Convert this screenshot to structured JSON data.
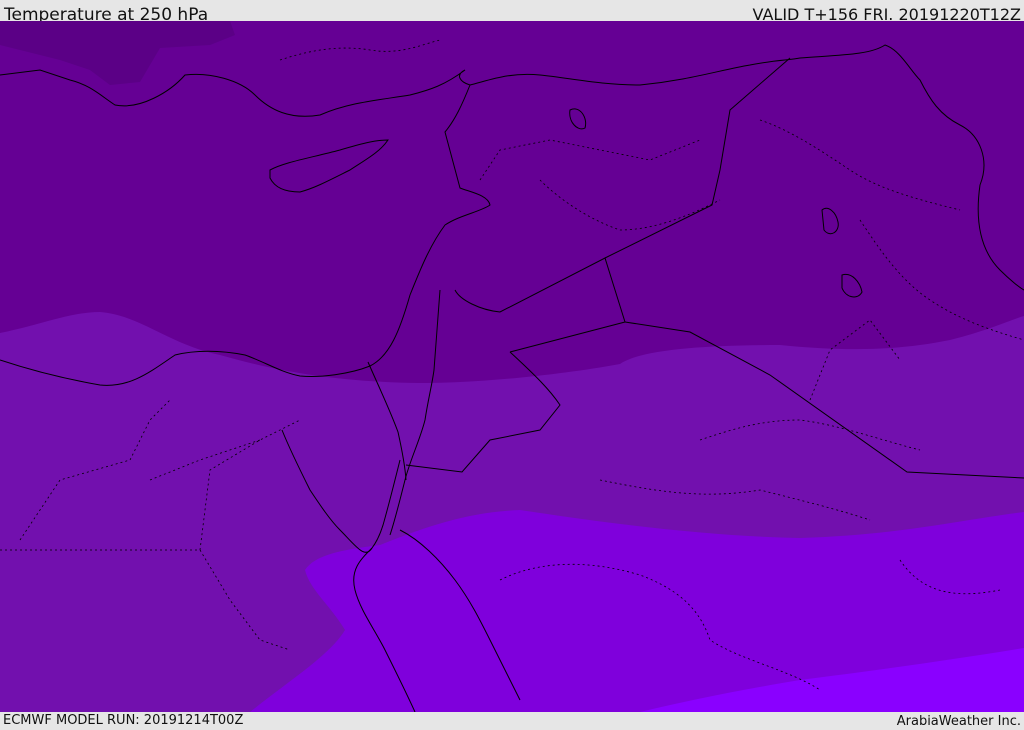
{
  "header": {
    "title": "Temperature at 250 hPa",
    "valid": "VALID T+156 FRI. 20191220T12Z"
  },
  "footer": {
    "model_run": "ECMWF MODEL RUN: 20191214T00Z",
    "credit": "ArabiaWeather Inc."
  },
  "colors": {
    "band_coldest": "#5b0086",
    "band_cold": "#650094",
    "band_mid": "#7210ae",
    "band_warm": "#7f00dc",
    "band_warmest": "#8a00ff",
    "coastline": "#000000",
    "border": "#000000"
  }
}
